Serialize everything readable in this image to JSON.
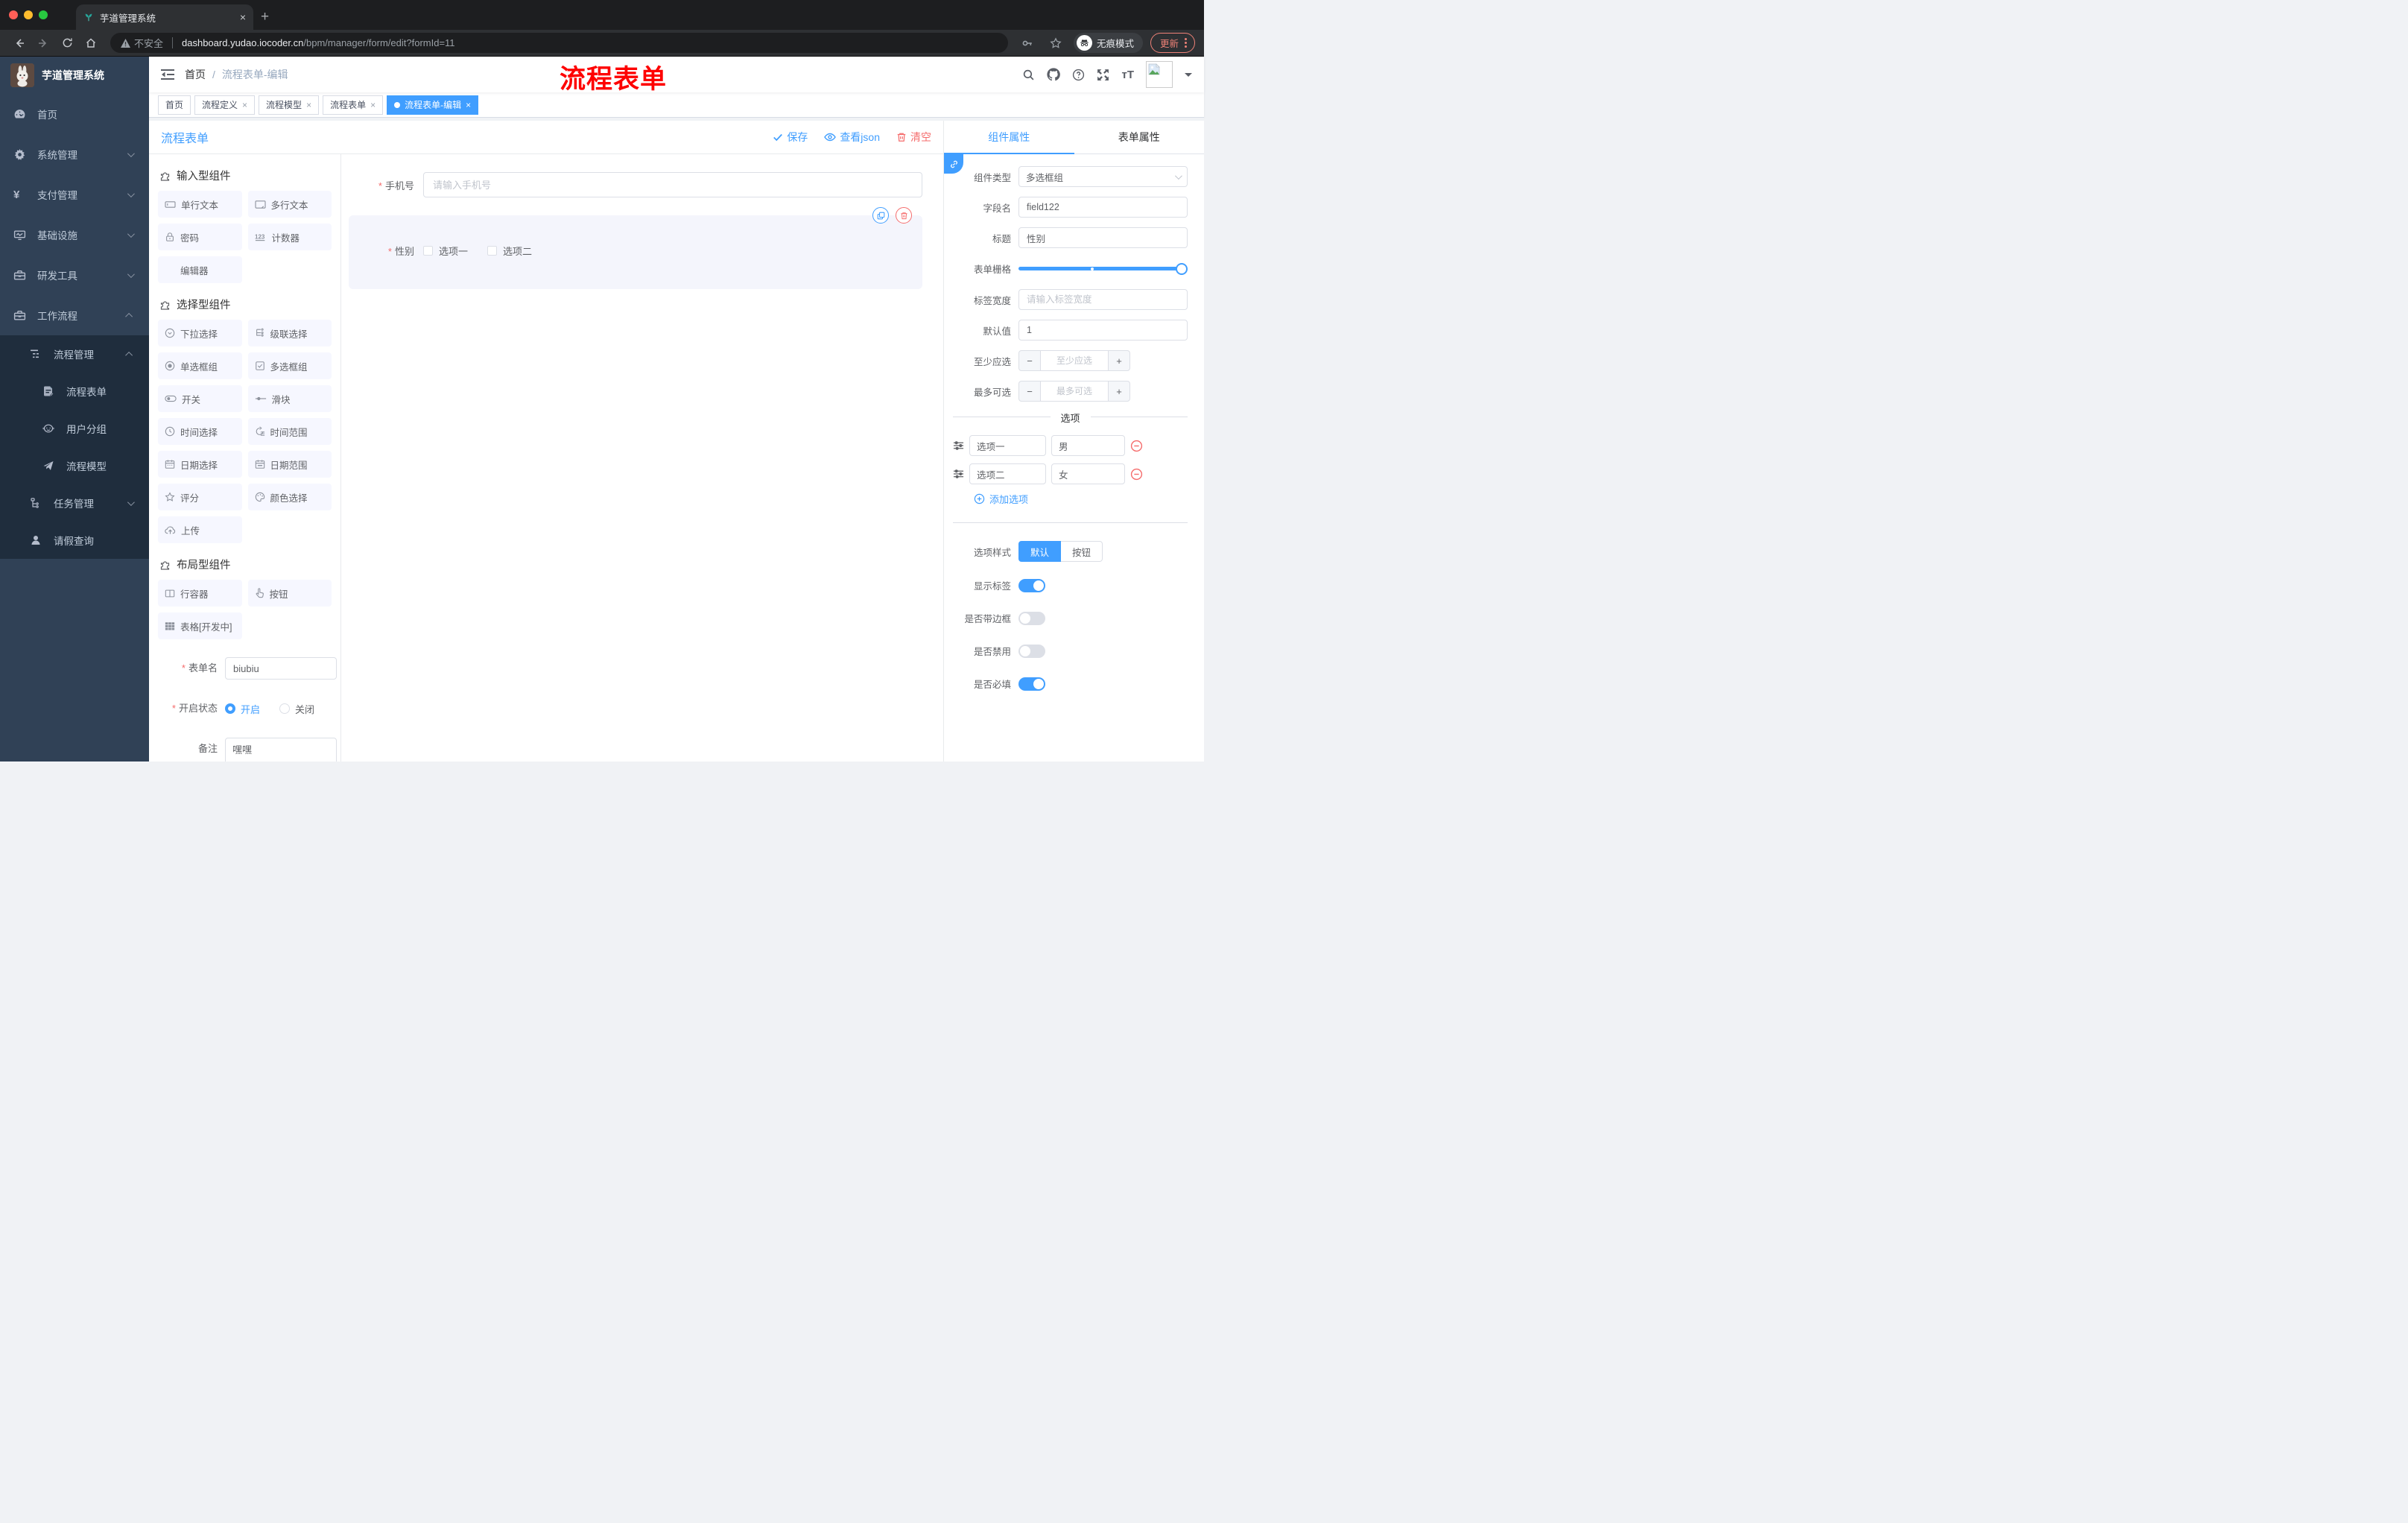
{
  "colors": {
    "accent": "#409eff",
    "danger": "#f56c6c",
    "sidebar_bg": "#304156",
    "submenu_bg": "#1f2d3d",
    "annotation_red": "#fe0000",
    "chrome_dark": "#1d1e20",
    "chrome_toolbar": "#2e3033"
  },
  "browser": {
    "tab_title": "芋道管理系统",
    "security_label": "不安全",
    "url_domain": "dashboard.yudao.iocoder.cn",
    "url_path": "/bpm/manager/form/edit?formId=11",
    "incognito_label": "无痕模式",
    "update_label": "更新"
  },
  "annotation": {
    "text": "流程表单"
  },
  "sidebar": {
    "brand": "芋道管理系统",
    "menu": [
      {
        "label": "首页",
        "icon": "dashboard-icon"
      },
      {
        "label": "系统管理",
        "icon": "gear-icon"
      },
      {
        "label": "支付管理",
        "icon": "yen-icon"
      },
      {
        "label": "基础设施",
        "icon": "monitor-icon"
      },
      {
        "label": "研发工具",
        "icon": "toolbox-icon"
      },
      {
        "label": "工作流程",
        "icon": "briefcase-icon"
      }
    ],
    "submenu": [
      {
        "label": "流程管理",
        "icon": "list-tree-icon"
      },
      {
        "label": "流程表单",
        "icon": "document-edit-icon"
      },
      {
        "label": "用户分组",
        "icon": "robot-icon"
      },
      {
        "label": "流程模型",
        "icon": "paper-plane-icon"
      },
      {
        "label": "任务管理",
        "icon": "org-tree-icon"
      },
      {
        "label": "请假查询",
        "icon": "user-icon"
      }
    ]
  },
  "header": {
    "breadcrumb_home": "首页",
    "breadcrumb_separator": "/",
    "breadcrumb_current": "流程表单-编辑"
  },
  "tags": [
    {
      "label": "首页"
    },
    {
      "label": "流程定义"
    },
    {
      "label": "流程模型"
    },
    {
      "label": "流程表单"
    },
    {
      "label": "流程表单-编辑"
    }
  ],
  "designer": {
    "title": "流程表单",
    "save_label": "保存",
    "view_json_label": "查看json",
    "clear_label": "清空"
  },
  "components": {
    "sections": [
      {
        "title": "输入型组件",
        "items": [
          {
            "label": "单行文本",
            "icon": "input-icon"
          },
          {
            "label": "多行文本",
            "icon": "textarea-icon"
          },
          {
            "label": "密码",
            "icon": "lock-icon"
          },
          {
            "label": "计数器",
            "icon": "counter-123-icon"
          },
          {
            "label": "编辑器",
            "icon": ""
          }
        ]
      },
      {
        "title": "选择型组件",
        "items": [
          {
            "label": "下拉选择",
            "icon": "select-icon"
          },
          {
            "label": "级联选择",
            "icon": "cascader-icon"
          },
          {
            "label": "单选框组",
            "icon": "radio-icon"
          },
          {
            "label": "多选框组",
            "icon": "checkbox-icon"
          },
          {
            "label": "开关",
            "icon": "switch-icon"
          },
          {
            "label": "滑块",
            "icon": "slider-icon"
          },
          {
            "label": "时间选择",
            "icon": "clock-icon"
          },
          {
            "label": "时间范围",
            "icon": "time-range-icon"
          },
          {
            "label": "日期选择",
            "icon": "calendar-icon"
          },
          {
            "label": "日期范围",
            "icon": "date-range-icon"
          },
          {
            "label": "评分",
            "icon": "star-icon"
          },
          {
            "label": "颜色选择",
            "icon": "palette-icon"
          },
          {
            "label": "上传",
            "icon": "cloud-upload-icon"
          }
        ]
      },
      {
        "title": "布局型组件",
        "items": [
          {
            "label": "行容器",
            "icon": "columns-icon"
          },
          {
            "label": "按钮",
            "icon": "pointer-icon"
          },
          {
            "label": "表格[开发中]",
            "icon": "table-icon"
          }
        ]
      }
    ]
  },
  "left_form": {
    "name_label": "表单名",
    "name_value": "biubiu",
    "status_label": "开启状态",
    "status_on": "开启",
    "status_off": "关闭",
    "remark_label": "备注",
    "remark_value": "嘿嘿"
  },
  "canvas": {
    "phone": {
      "label": "手机号",
      "placeholder": "请输入手机号"
    },
    "gender": {
      "label": "性别",
      "options": [
        "选项一",
        "选项二"
      ]
    }
  },
  "props": {
    "tab_component": "组件属性",
    "tab_form": "表单属性",
    "component_type_label": "组件类型",
    "component_type_value": "多选框组",
    "field_name_label": "字段名",
    "field_name_value": "field122",
    "title_label": "标题",
    "title_value": "性别",
    "grid_label": "表单栅格",
    "label_width_label": "标签宽度",
    "label_width_placeholder": "请输入标签宽度",
    "default_label": "默认值",
    "default_value": "1",
    "min_label": "至少应选",
    "min_placeholder": "至少应选",
    "max_label": "最多可选",
    "max_placeholder": "最多可选",
    "options_divider": "选项",
    "options": [
      {
        "label": "选项一",
        "value": "男"
      },
      {
        "label": "选项二",
        "value": "女"
      }
    ],
    "add_option_label": "添加选项",
    "option_style_label": "选项样式",
    "style_default": "默认",
    "style_button": "按钮",
    "show_label_label": "显示标签",
    "border_label": "是否带边框",
    "disabled_label": "是否禁用",
    "required_label": "是否必填"
  }
}
